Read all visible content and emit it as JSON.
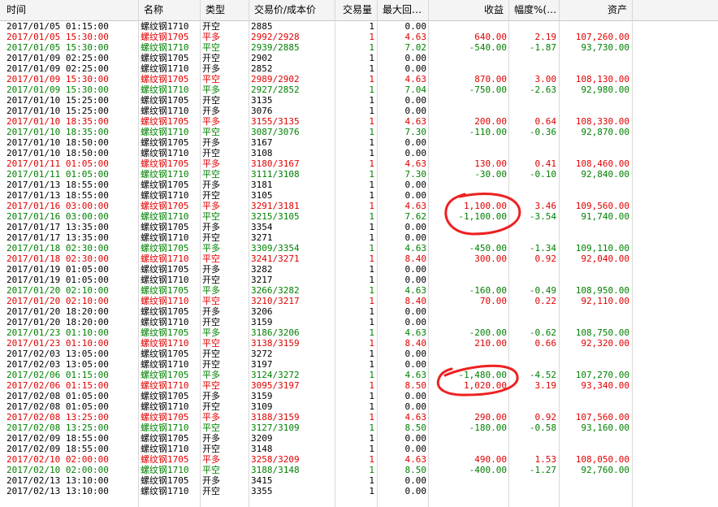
{
  "columns": {
    "time": "时间",
    "name": "名称",
    "type": "类型",
    "price": "交易价/成本价",
    "qty": "交易量",
    "maxr": "最大回…",
    "pnl": "收益",
    "pct": "幅度%(…",
    "asset": "资产"
  },
  "colors": {
    "red": "#e00000",
    "green": "#008000",
    "black": "#000000",
    "annotation": "#ee2020"
  },
  "rows": [
    {
      "color": "black",
      "time": "2017/01/05 01:15:00",
      "name": "螺纹钢1710",
      "type": "开空",
      "price": "2885",
      "qty": "1",
      "maxr": "0.00",
      "pnl": "",
      "pct": "",
      "asset": ""
    },
    {
      "color": "red",
      "time": "2017/01/05 15:30:00",
      "name": "螺纹钢1705",
      "type": "平多",
      "price": "2992/2928",
      "qty": "1",
      "maxr": "4.63",
      "pnl": "640.00",
      "pct": "2.19",
      "asset": "107,260.00"
    },
    {
      "color": "green",
      "time": "2017/01/05 15:30:00",
      "name": "螺纹钢1710",
      "type": "平空",
      "price": "2939/2885",
      "qty": "1",
      "maxr": "7.02",
      "pnl": "-540.00",
      "pct": "-1.87",
      "asset": "93,730.00"
    },
    {
      "color": "black",
      "time": "2017/01/09 02:25:00",
      "name": "螺纹钢1705",
      "type": "开空",
      "price": "2902",
      "qty": "1",
      "maxr": "0.00",
      "pnl": "",
      "pct": "",
      "asset": ""
    },
    {
      "color": "black",
      "time": "2017/01/09 02:25:00",
      "name": "螺纹钢1710",
      "type": "开多",
      "price": "2852",
      "qty": "1",
      "maxr": "0.00",
      "pnl": "",
      "pct": "",
      "asset": ""
    },
    {
      "color": "red",
      "time": "2017/01/09 15:30:00",
      "name": "螺纹钢1705",
      "type": "平空",
      "price": "2989/2902",
      "qty": "1",
      "maxr": "4.63",
      "pnl": "870.00",
      "pct": "3.00",
      "asset": "108,130.00"
    },
    {
      "color": "green",
      "time": "2017/01/09 15:30:00",
      "name": "螺纹钢1710",
      "type": "平多",
      "price": "2927/2852",
      "qty": "1",
      "maxr": "7.04",
      "pnl": "-750.00",
      "pct": "-2.63",
      "asset": "92,980.00"
    },
    {
      "color": "black",
      "time": "2017/01/10 15:25:00",
      "name": "螺纹钢1705",
      "type": "开空",
      "price": "3135",
      "qty": "1",
      "maxr": "0.00",
      "pnl": "",
      "pct": "",
      "asset": ""
    },
    {
      "color": "black",
      "time": "2017/01/10 15:25:00",
      "name": "螺纹钢1710",
      "type": "开多",
      "price": "3076",
      "qty": "1",
      "maxr": "0.00",
      "pnl": "",
      "pct": "",
      "asset": ""
    },
    {
      "color": "red",
      "time": "2017/01/10 18:35:00",
      "name": "螺纹钢1705",
      "type": "平多",
      "price": "3155/3135",
      "qty": "1",
      "maxr": "4.63",
      "pnl": "200.00",
      "pct": "0.64",
      "asset": "108,330.00"
    },
    {
      "color": "green",
      "time": "2017/01/10 18:35:00",
      "name": "螺纹钢1710",
      "type": "平空",
      "price": "3087/3076",
      "qty": "1",
      "maxr": "7.30",
      "pnl": "-110.00",
      "pct": "-0.36",
      "asset": "92,870.00"
    },
    {
      "color": "black",
      "time": "2017/01/10 18:50:00",
      "name": "螺纹钢1705",
      "type": "开多",
      "price": "3167",
      "qty": "1",
      "maxr": "0.00",
      "pnl": "",
      "pct": "",
      "asset": ""
    },
    {
      "color": "black",
      "time": "2017/01/10 18:50:00",
      "name": "螺纹钢1710",
      "type": "开空",
      "price": "3108",
      "qty": "1",
      "maxr": "0.00",
      "pnl": "",
      "pct": "",
      "asset": ""
    },
    {
      "color": "red",
      "time": "2017/01/11 01:05:00",
      "name": "螺纹钢1705",
      "type": "平多",
      "price": "3180/3167",
      "qty": "1",
      "maxr": "4.63",
      "pnl": "130.00",
      "pct": "0.41",
      "asset": "108,460.00"
    },
    {
      "color": "green",
      "time": "2017/01/11 01:05:00",
      "name": "螺纹钢1710",
      "type": "平空",
      "price": "3111/3108",
      "qty": "1",
      "maxr": "7.30",
      "pnl": "-30.00",
      "pct": "-0.10",
      "asset": "92,840.00"
    },
    {
      "color": "black",
      "time": "2017/01/13 18:55:00",
      "name": "螺纹钢1705",
      "type": "开多",
      "price": "3181",
      "qty": "1",
      "maxr": "0.00",
      "pnl": "",
      "pct": "",
      "asset": ""
    },
    {
      "color": "black",
      "time": "2017/01/13 18:55:00",
      "name": "螺纹钢1710",
      "type": "开空",
      "price": "3105",
      "qty": "1",
      "maxr": "0.00",
      "pnl": "",
      "pct": "",
      "asset": ""
    },
    {
      "color": "red",
      "time": "2017/01/16 03:00:00",
      "name": "螺纹钢1705",
      "type": "平多",
      "price": "3291/3181",
      "qty": "1",
      "maxr": "4.63",
      "pnl": "1,100.00",
      "pct": "3.46",
      "asset": "109,560.00"
    },
    {
      "color": "green",
      "time": "2017/01/16 03:00:00",
      "name": "螺纹钢1710",
      "type": "平空",
      "price": "3215/3105",
      "qty": "1",
      "maxr": "7.62",
      "pnl": "-1,100.00",
      "pct": "-3.54",
      "asset": "91,740.00"
    },
    {
      "color": "black",
      "time": "2017/01/17 13:35:00",
      "name": "螺纹钢1705",
      "type": "开多",
      "price": "3354",
      "qty": "1",
      "maxr": "0.00",
      "pnl": "",
      "pct": "",
      "asset": ""
    },
    {
      "color": "black",
      "time": "2017/01/17 13:35:00",
      "name": "螺纹钢1710",
      "type": "开空",
      "price": "3271",
      "qty": "1",
      "maxr": "0.00",
      "pnl": "",
      "pct": "",
      "asset": ""
    },
    {
      "color": "green",
      "time": "2017/01/18 02:30:00",
      "name": "螺纹钢1705",
      "type": "平多",
      "price": "3309/3354",
      "qty": "1",
      "maxr": "4.63",
      "pnl": "-450.00",
      "pct": "-1.34",
      "asset": "109,110.00"
    },
    {
      "color": "red",
      "time": "2017/01/18 02:30:00",
      "name": "螺纹钢1710",
      "type": "平空",
      "price": "3241/3271",
      "qty": "1",
      "maxr": "8.40",
      "pnl": "300.00",
      "pct": "0.92",
      "asset": "92,040.00"
    },
    {
      "color": "black",
      "time": "2017/01/19 01:05:00",
      "name": "螺纹钢1705",
      "type": "开多",
      "price": "3282",
      "qty": "1",
      "maxr": "0.00",
      "pnl": "",
      "pct": "",
      "asset": ""
    },
    {
      "color": "black",
      "time": "2017/01/19 01:05:00",
      "name": "螺纹钢1710",
      "type": "开空",
      "price": "3217",
      "qty": "1",
      "maxr": "0.00",
      "pnl": "",
      "pct": "",
      "asset": ""
    },
    {
      "color": "green",
      "time": "2017/01/20 02:10:00",
      "name": "螺纹钢1705",
      "type": "平多",
      "price": "3266/3282",
      "qty": "1",
      "maxr": "4.63",
      "pnl": "-160.00",
      "pct": "-0.49",
      "asset": "108,950.00"
    },
    {
      "color": "red",
      "time": "2017/01/20 02:10:00",
      "name": "螺纹钢1710",
      "type": "平空",
      "price": "3210/3217",
      "qty": "1",
      "maxr": "8.40",
      "pnl": "70.00",
      "pct": "0.22",
      "asset": "92,110.00"
    },
    {
      "color": "black",
      "time": "2017/01/20 18:20:00",
      "name": "螺纹钢1705",
      "type": "开多",
      "price": "3206",
      "qty": "1",
      "maxr": "0.00",
      "pnl": "",
      "pct": "",
      "asset": ""
    },
    {
      "color": "black",
      "time": "2017/01/20 18:20:00",
      "name": "螺纹钢1710",
      "type": "开空",
      "price": "3159",
      "qty": "1",
      "maxr": "0.00",
      "pnl": "",
      "pct": "",
      "asset": ""
    },
    {
      "color": "green",
      "time": "2017/01/23 01:10:00",
      "name": "螺纹钢1705",
      "type": "平多",
      "price": "3186/3206",
      "qty": "1",
      "maxr": "4.63",
      "pnl": "-200.00",
      "pct": "-0.62",
      "asset": "108,750.00"
    },
    {
      "color": "red",
      "time": "2017/01/23 01:10:00",
      "name": "螺纹钢1710",
      "type": "平空",
      "price": "3138/3159",
      "qty": "1",
      "maxr": "8.40",
      "pnl": "210.00",
      "pct": "0.66",
      "asset": "92,320.00"
    },
    {
      "color": "black",
      "time": "2017/02/03 13:05:00",
      "name": "螺纹钢1705",
      "type": "开空",
      "price": "3272",
      "qty": "1",
      "maxr": "0.00",
      "pnl": "",
      "pct": "",
      "asset": ""
    },
    {
      "color": "black",
      "time": "2017/02/03 13:05:00",
      "name": "螺纹钢1710",
      "type": "开空",
      "price": "3197",
      "qty": "1",
      "maxr": "0.00",
      "pnl": "",
      "pct": "",
      "asset": ""
    },
    {
      "color": "green",
      "time": "2017/02/06 01:15:00",
      "name": "螺纹钢1705",
      "type": "平多",
      "price": "3124/3272",
      "qty": "1",
      "maxr": "4.63",
      "pnl": "-1,480.00",
      "pct": "-4.52",
      "asset": "107,270.00"
    },
    {
      "color": "red",
      "time": "2017/02/06 01:15:00",
      "name": "螺纹钢1710",
      "type": "平空",
      "price": "3095/3197",
      "qty": "1",
      "maxr": "8.50",
      "pnl": "1,020.00",
      "pct": "3.19",
      "asset": "93,340.00"
    },
    {
      "color": "black",
      "time": "2017/02/08 01:05:00",
      "name": "螺纹钢1705",
      "type": "开多",
      "price": "3159",
      "qty": "1",
      "maxr": "0.00",
      "pnl": "",
      "pct": "",
      "asset": ""
    },
    {
      "color": "black",
      "time": "2017/02/08 01:05:00",
      "name": "螺纹钢1710",
      "type": "开空",
      "price": "3109",
      "qty": "1",
      "maxr": "0.00",
      "pnl": "",
      "pct": "",
      "asset": ""
    },
    {
      "color": "red",
      "time": "2017/02/08 13:25:00",
      "name": "螺纹钢1705",
      "type": "平多",
      "price": "3188/3159",
      "qty": "1",
      "maxr": "4.63",
      "pnl": "290.00",
      "pct": "0.92",
      "asset": "107,560.00"
    },
    {
      "color": "green",
      "time": "2017/02/08 13:25:00",
      "name": "螺纹钢1710",
      "type": "平空",
      "price": "3127/3109",
      "qty": "1",
      "maxr": "8.50",
      "pnl": "-180.00",
      "pct": "-0.58",
      "asset": "93,160.00"
    },
    {
      "color": "black",
      "time": "2017/02/09 18:55:00",
      "name": "螺纹钢1705",
      "type": "开多",
      "price": "3209",
      "qty": "1",
      "maxr": "0.00",
      "pnl": "",
      "pct": "",
      "asset": ""
    },
    {
      "color": "black",
      "time": "2017/02/09 18:55:00",
      "name": "螺纹钢1710",
      "type": "开空",
      "price": "3148",
      "qty": "1",
      "maxr": "0.00",
      "pnl": "",
      "pct": "",
      "asset": ""
    },
    {
      "color": "red",
      "time": "2017/02/10 02:00:00",
      "name": "螺纹钢1705",
      "type": "平多",
      "price": "3258/3209",
      "qty": "1",
      "maxr": "4.63",
      "pnl": "490.00",
      "pct": "1.53",
      "asset": "108,050.00"
    },
    {
      "color": "green",
      "time": "2017/02/10 02:00:00",
      "name": "螺纹钢1710",
      "type": "平空",
      "price": "3188/3148",
      "qty": "1",
      "maxr": "8.50",
      "pnl": "-400.00",
      "pct": "-1.27",
      "asset": "92,760.00"
    },
    {
      "color": "black",
      "time": "2017/02/13 13:10:00",
      "name": "螺纹钢1705",
      "type": "开多",
      "price": "3415",
      "qty": "1",
      "maxr": "0.00",
      "pnl": "",
      "pct": "",
      "asset": ""
    },
    {
      "color": "black",
      "time": "2017/02/13 13:10:00",
      "name": "螺纹钢1710",
      "type": "开空",
      "price": "3355",
      "qty": "1",
      "maxr": "0.00",
      "pnl": "",
      "pct": "",
      "asset": ""
    }
  ]
}
